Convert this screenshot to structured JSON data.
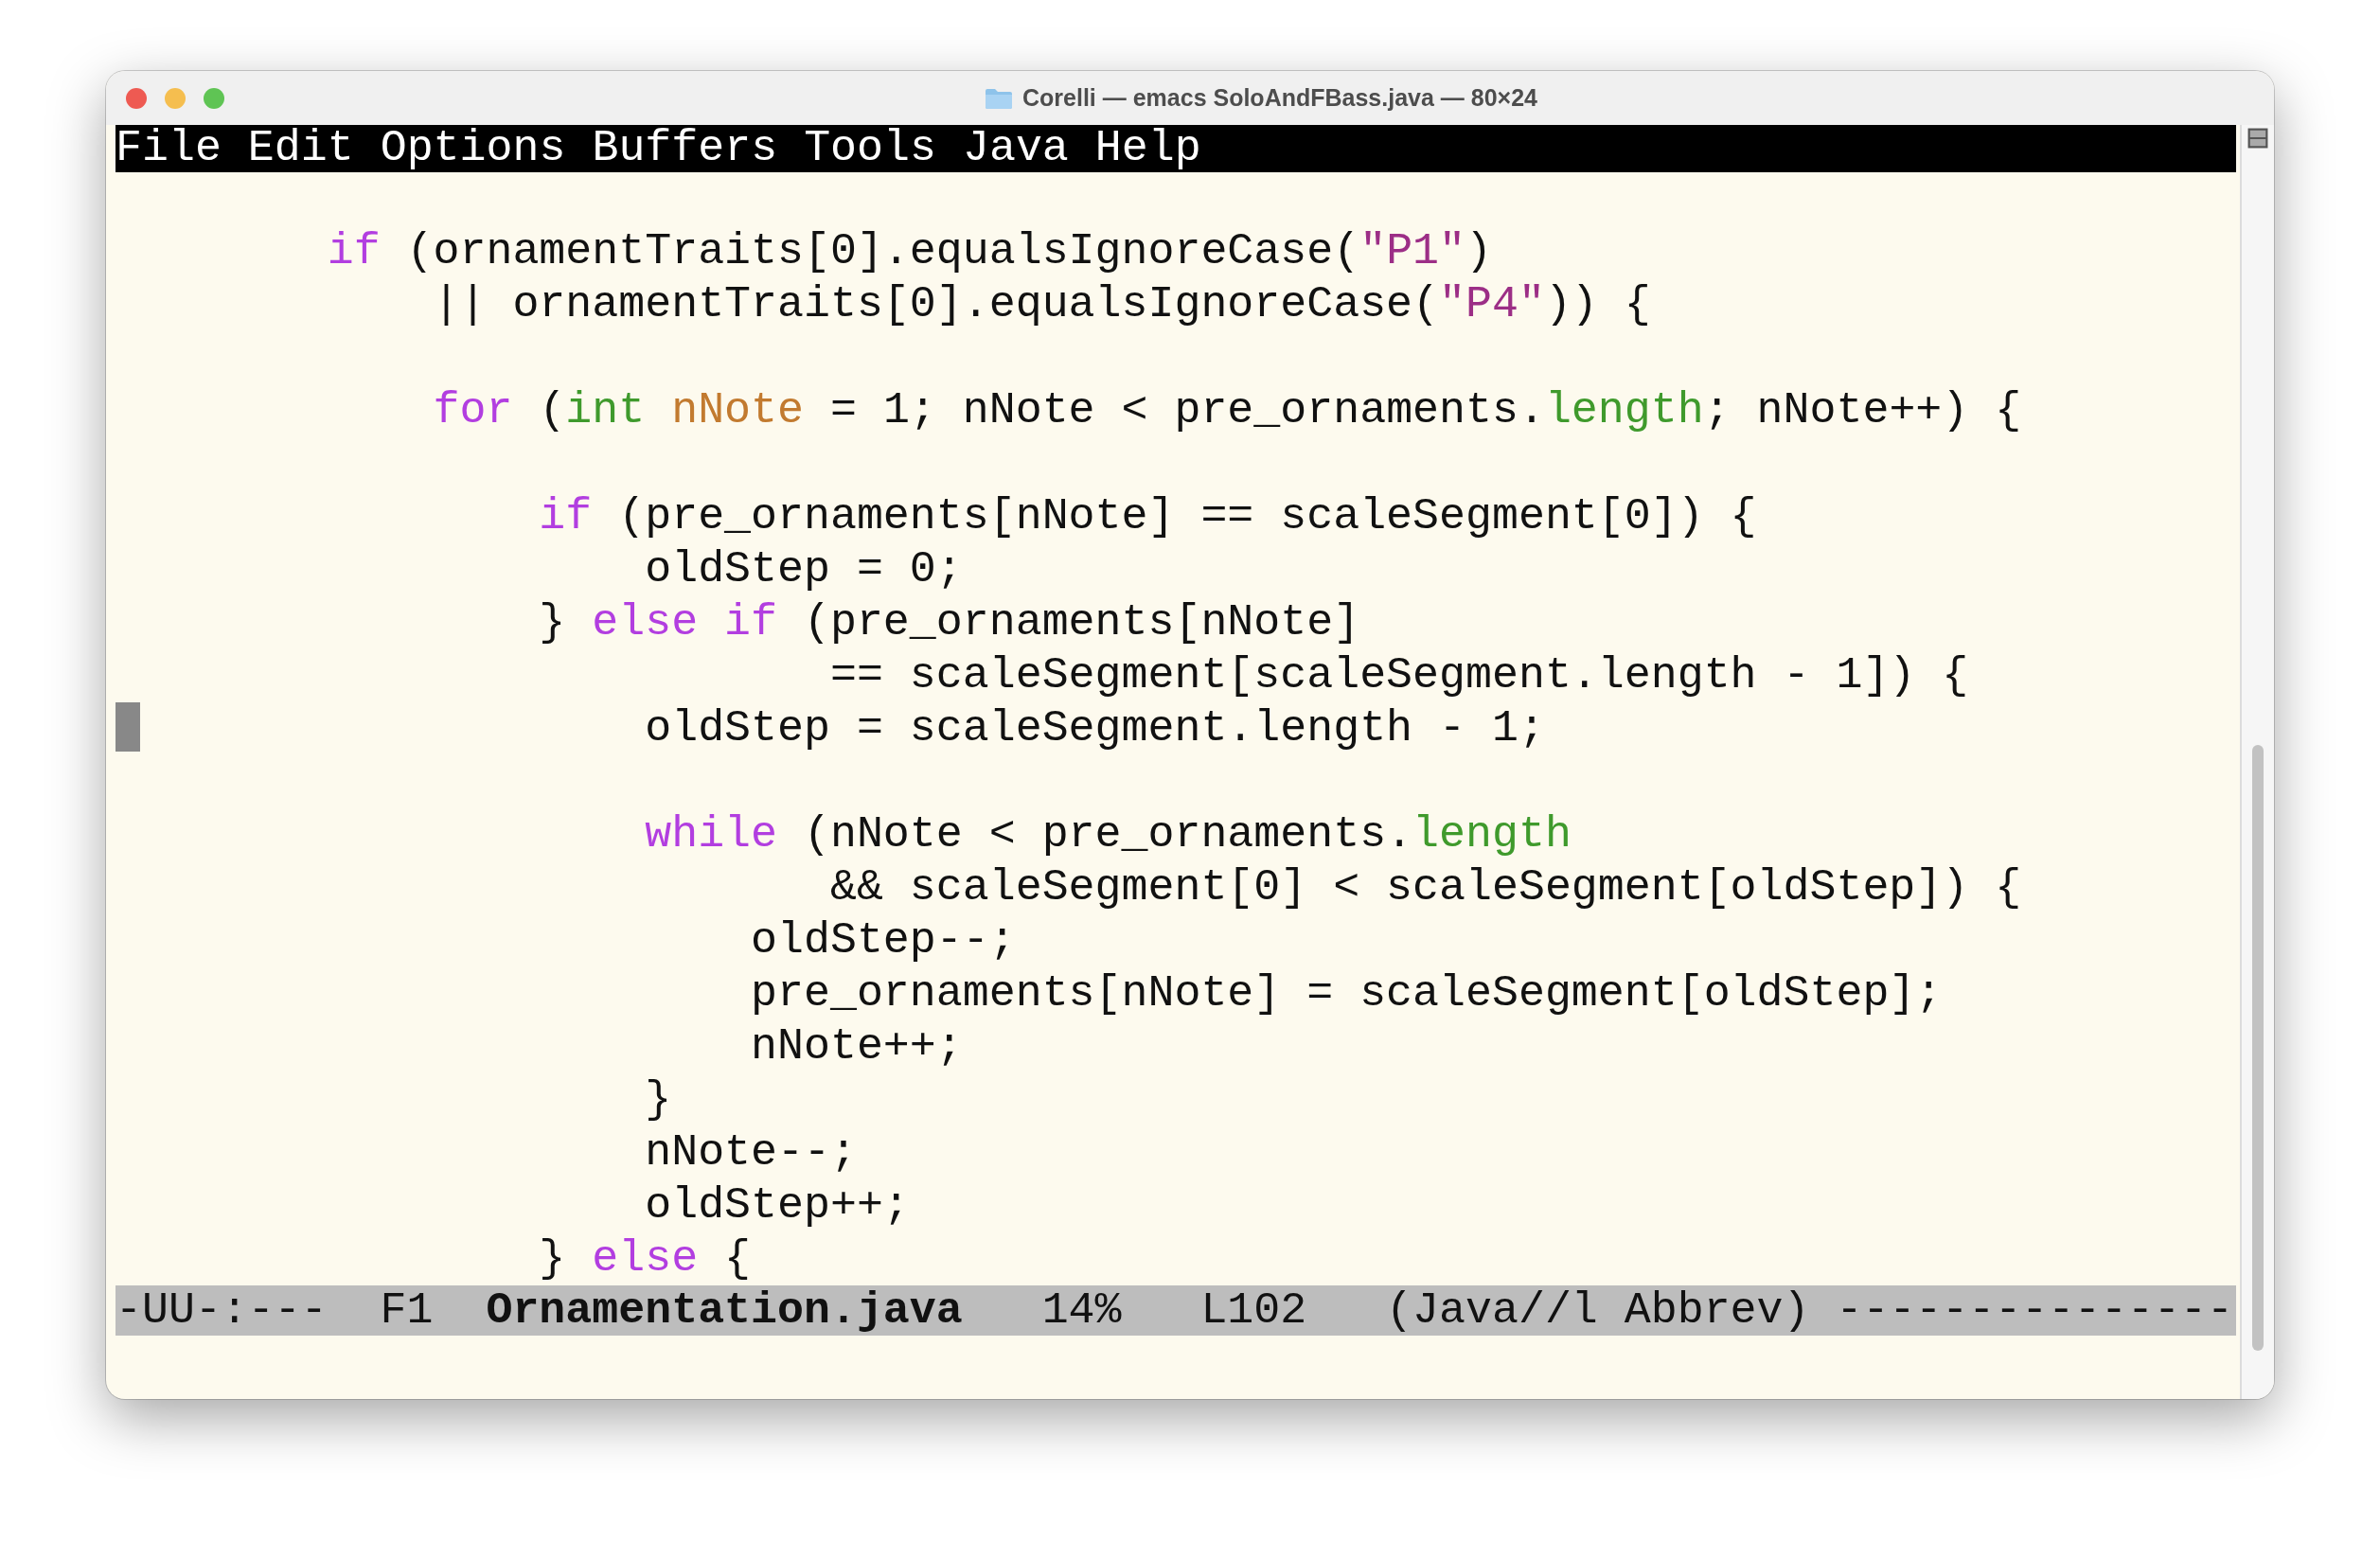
{
  "window": {
    "title": "Corelli — emacs SoloAndFBass.java — 80×24"
  },
  "menu": [
    "File",
    "Edit",
    "Options",
    "Buffers",
    "Tools",
    "Java",
    "Help"
  ],
  "lines": [
    {
      "cursor": false
    },
    {
      "cursor": false,
      "segments": [
        {
          "text": "        if",
          "kind": "keyword"
        },
        {
          "text": " (ornamentTraits[0].equalsIgnoreCase(",
          "kind": "plain"
        },
        {
          "text": "\"P1\"",
          "kind": "string"
        },
        {
          "text": ")",
          "kind": "plain"
        }
      ]
    },
    {
      "cursor": false,
      "segments": [
        {
          "text": "            || ornamentTraits[0].equalsIgnoreCase(",
          "kind": "plain"
        },
        {
          "text": "\"P4\"",
          "kind": "string"
        },
        {
          "text": ")) {",
          "kind": "plain"
        }
      ]
    },
    {
      "cursor": false
    },
    {
      "cursor": false,
      "segments": [
        {
          "text": "            for",
          "kind": "keyword"
        },
        {
          "text": " (",
          "kind": "plain"
        },
        {
          "text": "int",
          "kind": "type"
        },
        {
          "text": " nNote",
          "kind": "variable"
        },
        {
          "text": " = 1; nNote < pre_ornaments.",
          "kind": "plain"
        },
        {
          "text": "length",
          "kind": "type"
        },
        {
          "text": "; nNote++) {",
          "kind": "plain"
        }
      ]
    },
    {
      "cursor": false
    },
    {
      "cursor": false,
      "segments": [
        {
          "text": "                if",
          "kind": "keyword"
        },
        {
          "text": " (pre_ornaments[nNote] == scaleSegment[0]) {",
          "kind": "plain"
        }
      ]
    },
    {
      "cursor": false,
      "segments": [
        {
          "text": "                    oldStep = 0;",
          "kind": "plain"
        }
      ]
    },
    {
      "cursor": false,
      "segments": [
        {
          "text": "                } ",
          "kind": "plain"
        },
        {
          "text": "else",
          "kind": "keyword"
        },
        {
          "text": " if",
          "kind": "keyword"
        },
        {
          "text": " (pre_ornaments[nNote]",
          "kind": "plain"
        }
      ]
    },
    {
      "cursor": false,
      "segments": [
        {
          "text": "                           == scaleSegment[scaleSegment.length - 1]) {",
          "kind": "plain"
        }
      ]
    },
    {
      "cursor": true,
      "segments": [
        {
          "text": "                    oldStep = scaleSegment.length - 1;",
          "kind": "plain"
        }
      ]
    },
    {
      "cursor": false
    },
    {
      "cursor": false,
      "segments": [
        {
          "text": "                    while",
          "kind": "keyword"
        },
        {
          "text": " (nNote < pre_ornaments.",
          "kind": "plain"
        },
        {
          "text": "length",
          "kind": "type"
        }
      ]
    },
    {
      "cursor": false,
      "segments": [
        {
          "text": "                           && scaleSegment[0] < scaleSegment[oldStep]) {",
          "kind": "plain"
        }
      ]
    },
    {
      "cursor": false,
      "segments": [
        {
          "text": "                        oldStep--;",
          "kind": "plain"
        }
      ]
    },
    {
      "cursor": false,
      "segments": [
        {
          "text": "                        pre_ornaments[nNote] = scaleSegment[oldStep];",
          "kind": "plain"
        }
      ]
    },
    {
      "cursor": false,
      "segments": [
        {
          "text": "                        nNote++;",
          "kind": "plain"
        }
      ]
    },
    {
      "cursor": false,
      "segments": [
        {
          "text": "                    }",
          "kind": "plain"
        }
      ]
    },
    {
      "cursor": false,
      "segments": [
        {
          "text": "                    nNote--;",
          "kind": "plain"
        }
      ]
    },
    {
      "cursor": false,
      "segments": [
        {
          "text": "                    oldStep++;",
          "kind": "plain"
        }
      ]
    },
    {
      "cursor": false,
      "segments": [
        {
          "text": "                } ",
          "kind": "plain"
        },
        {
          "text": "else",
          "kind": "keyword"
        },
        {
          "text": " {",
          "kind": "plain"
        }
      ]
    }
  ],
  "mode_line": "-UU-:---  F1  **Ornamentation.java**   14%   L102   (Java//l Abbrev) ---------------"
}
